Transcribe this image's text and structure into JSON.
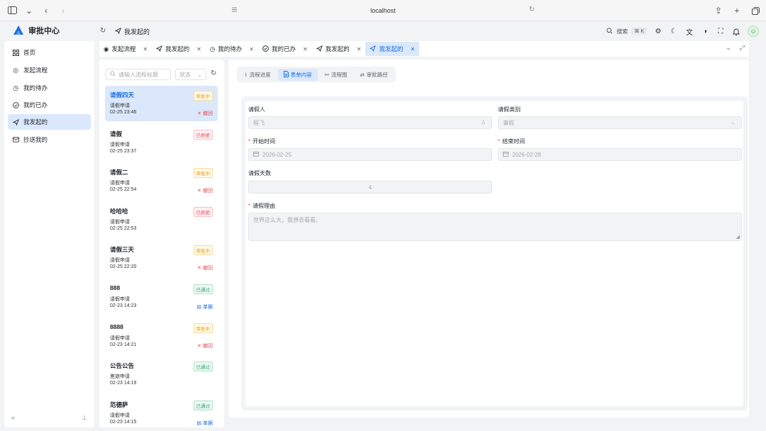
{
  "browser": {
    "url": "localhost"
  },
  "header": {
    "app_title": "审批中心",
    "breadcrumb": "我发起的",
    "search_label": "搜索",
    "search_shortcut": "⌘ K"
  },
  "sidebar": {
    "items": [
      {
        "label": "首页",
        "icon": "dashboard-icon"
      },
      {
        "label": "发起流程",
        "icon": "play-circle-icon"
      },
      {
        "label": "我的待办",
        "icon": "clock-icon"
      },
      {
        "label": "我的已办",
        "icon": "check-circle-icon"
      },
      {
        "label": "我发起的",
        "icon": "send-icon",
        "active": true
      },
      {
        "label": "抄送我的",
        "icon": "mail-icon"
      }
    ]
  },
  "tabs": [
    {
      "label": "发起流程",
      "icon": "play-circle-icon"
    },
    {
      "label": "我发起的",
      "icon": "send-icon"
    },
    {
      "label": "我的待办",
      "icon": "clock-icon"
    },
    {
      "label": "我的已办",
      "icon": "check-circle-icon"
    },
    {
      "label": "我发起的",
      "icon": "send-icon"
    },
    {
      "label": "我发起的",
      "icon": "send-icon",
      "active": true
    }
  ],
  "list": {
    "search_placeholder": "请输入流程标题",
    "status_placeholder": "状态",
    "items": [
      {
        "title": "请假四天",
        "type": "请假申请",
        "time": "02-25 23:46",
        "status": "审批中",
        "status_kind": "pending",
        "action": "撤回",
        "action_kind": "withdraw",
        "active": true
      },
      {
        "title": "请假",
        "type": "请假申请",
        "time": "02-25 23:37",
        "status": "已拒绝",
        "status_kind": "rejected",
        "action": "",
        "action_kind": ""
      },
      {
        "title": "请假二",
        "type": "请假申请",
        "time": "02-25 22:54",
        "status": "审批中",
        "status_kind": "pending",
        "action": "撤回",
        "action_kind": "withdraw"
      },
      {
        "title": "哈哈哈",
        "type": "请假申请",
        "time": "02-25 22:53",
        "status": "已拒绝",
        "status_kind": "rejected",
        "action": "",
        "action_kind": ""
      },
      {
        "title": "请假三天",
        "type": "请假申请",
        "time": "02-25 22:20",
        "status": "审批中",
        "status_kind": "pending",
        "action": "撤回",
        "action_kind": "withdraw"
      },
      {
        "title": "888",
        "type": "请假申请",
        "time": "02-23 14:23",
        "status": "已通过",
        "status_kind": "approved",
        "action": "单据",
        "action_kind": "urge"
      },
      {
        "title": "8888",
        "type": "请假申请",
        "time": "02-23 14:21",
        "status": "审批中",
        "status_kind": "pending",
        "action": "撤回",
        "action_kind": "withdraw"
      },
      {
        "title": "公告公告",
        "type": "差旅申请",
        "time": "02-23 14:19",
        "status": "已通过",
        "status_kind": "approved",
        "action": "",
        "action_kind": ""
      },
      {
        "title": "范德萨",
        "type": "请假申请",
        "time": "02-23 14:15",
        "status": "已通过",
        "status_kind": "approved",
        "action": "单据",
        "action_kind": "urge"
      }
    ]
  },
  "detail": {
    "tabs": [
      {
        "label": "流程进度",
        "icon": "route-icon"
      },
      {
        "label": "表单内容",
        "icon": "document-icon",
        "active": true
      },
      {
        "label": "流程图",
        "icon": "flow-icon"
      },
      {
        "label": "审批路径",
        "icon": "path-icon"
      }
    ],
    "form": {
      "applicant_label": "请假人",
      "applicant_value": "程飞",
      "category_label": "请假类别",
      "category_value": "事假",
      "start_label": "开始时间",
      "start_value": "2026-02-25",
      "end_label": "结束时间",
      "end_value": "2026-02-28",
      "days_label": "请假天数",
      "days_value": "4",
      "reason_label": "请假理由",
      "reason_value": "世界这么大，我想去看看。"
    }
  },
  "colors": {
    "accent": "#1a6fe0",
    "active_bg": "#dbe8fb",
    "pending": "#e3a21a",
    "rejected": "#e34d59",
    "approved": "#2ba471"
  }
}
